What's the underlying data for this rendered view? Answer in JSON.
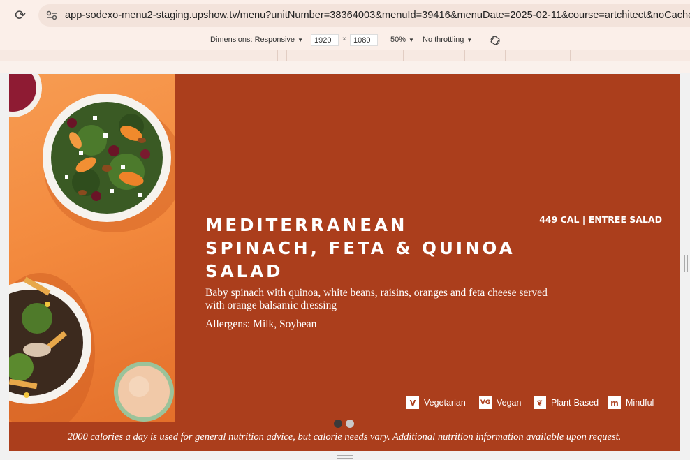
{
  "browser": {
    "url": "app-sodexo-menu2-staging.upshow.tv/menu?unitNumber=38364003&menuId=39416&menuDate=2025-02-11&course=artchitect&noCache=true",
    "reload_icon": "reload-icon",
    "site_info_icon": "tune-icon"
  },
  "devtools": {
    "dimensions_label": "Dimensions: Responsive",
    "width": "1920",
    "height": "1080",
    "times": "×",
    "zoom": "50%",
    "throttling": "No throttling",
    "rotate_icon": "rotate-icon"
  },
  "menu": {
    "title_lines": [
      "MEDITERRANEAN",
      "SPINACH, FETA & QUINOA",
      "SALAD"
    ],
    "calories": "449 CAL | ENTREE SALAD",
    "description": "Baby spinach with quinoa, white beans, raisins, oranges and feta cheese served with orange balsamic dressing",
    "allergens": "Allergens: Milk, Soybean",
    "diet_tags": [
      {
        "label": "Vegetarian",
        "icon_text": "V"
      },
      {
        "label": "Vegan",
        "icon_text": "VG"
      },
      {
        "label": "Plant-Based",
        "icon_text": "❦"
      },
      {
        "label": "Mindful",
        "icon_text": "m"
      }
    ],
    "footer": "2000 calories a day is used for general nutrition advice, but calorie needs vary. Additional nutrition information available upon request.",
    "carousel": {
      "count": 2,
      "active_index": 0
    }
  },
  "colors": {
    "background": "#ab3e1c",
    "photo_background": "#f38a3e",
    "text": "#ffffff"
  }
}
